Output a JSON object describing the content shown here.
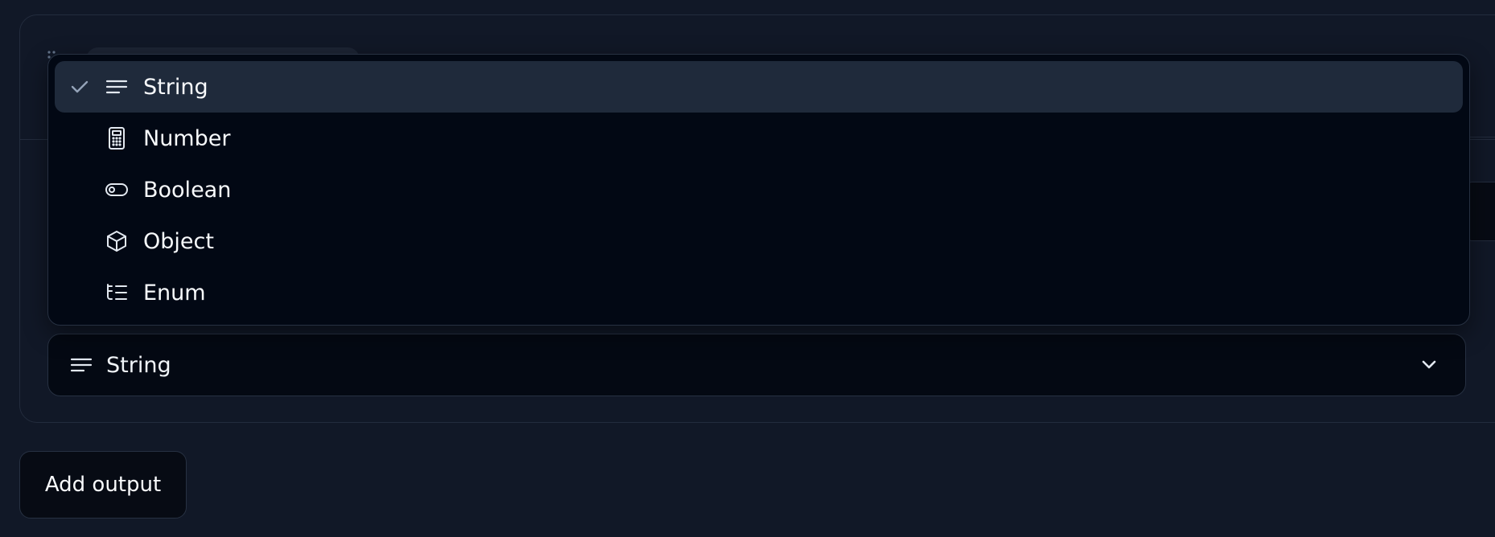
{
  "output_card": {
    "type_select": {
      "selected_value": "String",
      "selected_icon": "lines-icon"
    },
    "dropdown": {
      "items": [
        {
          "label": "String",
          "icon": "lines-icon",
          "selected": true
        },
        {
          "label": "Number",
          "icon": "calculator-icon",
          "selected": false
        },
        {
          "label": "Boolean",
          "icon": "toggle-icon",
          "selected": false
        },
        {
          "label": "Object",
          "icon": "cube-icon",
          "selected": false
        },
        {
          "label": "Enum",
          "icon": "list-tree-icon",
          "selected": false
        }
      ]
    }
  },
  "actions": {
    "add_output_label": "Add output"
  },
  "colors": {
    "page_background": "#111827",
    "menu_background": "#020814",
    "selected_row": "#1f2a3b",
    "border": "#273142",
    "text": "#f8fafc",
    "check": "#94a3b8"
  }
}
